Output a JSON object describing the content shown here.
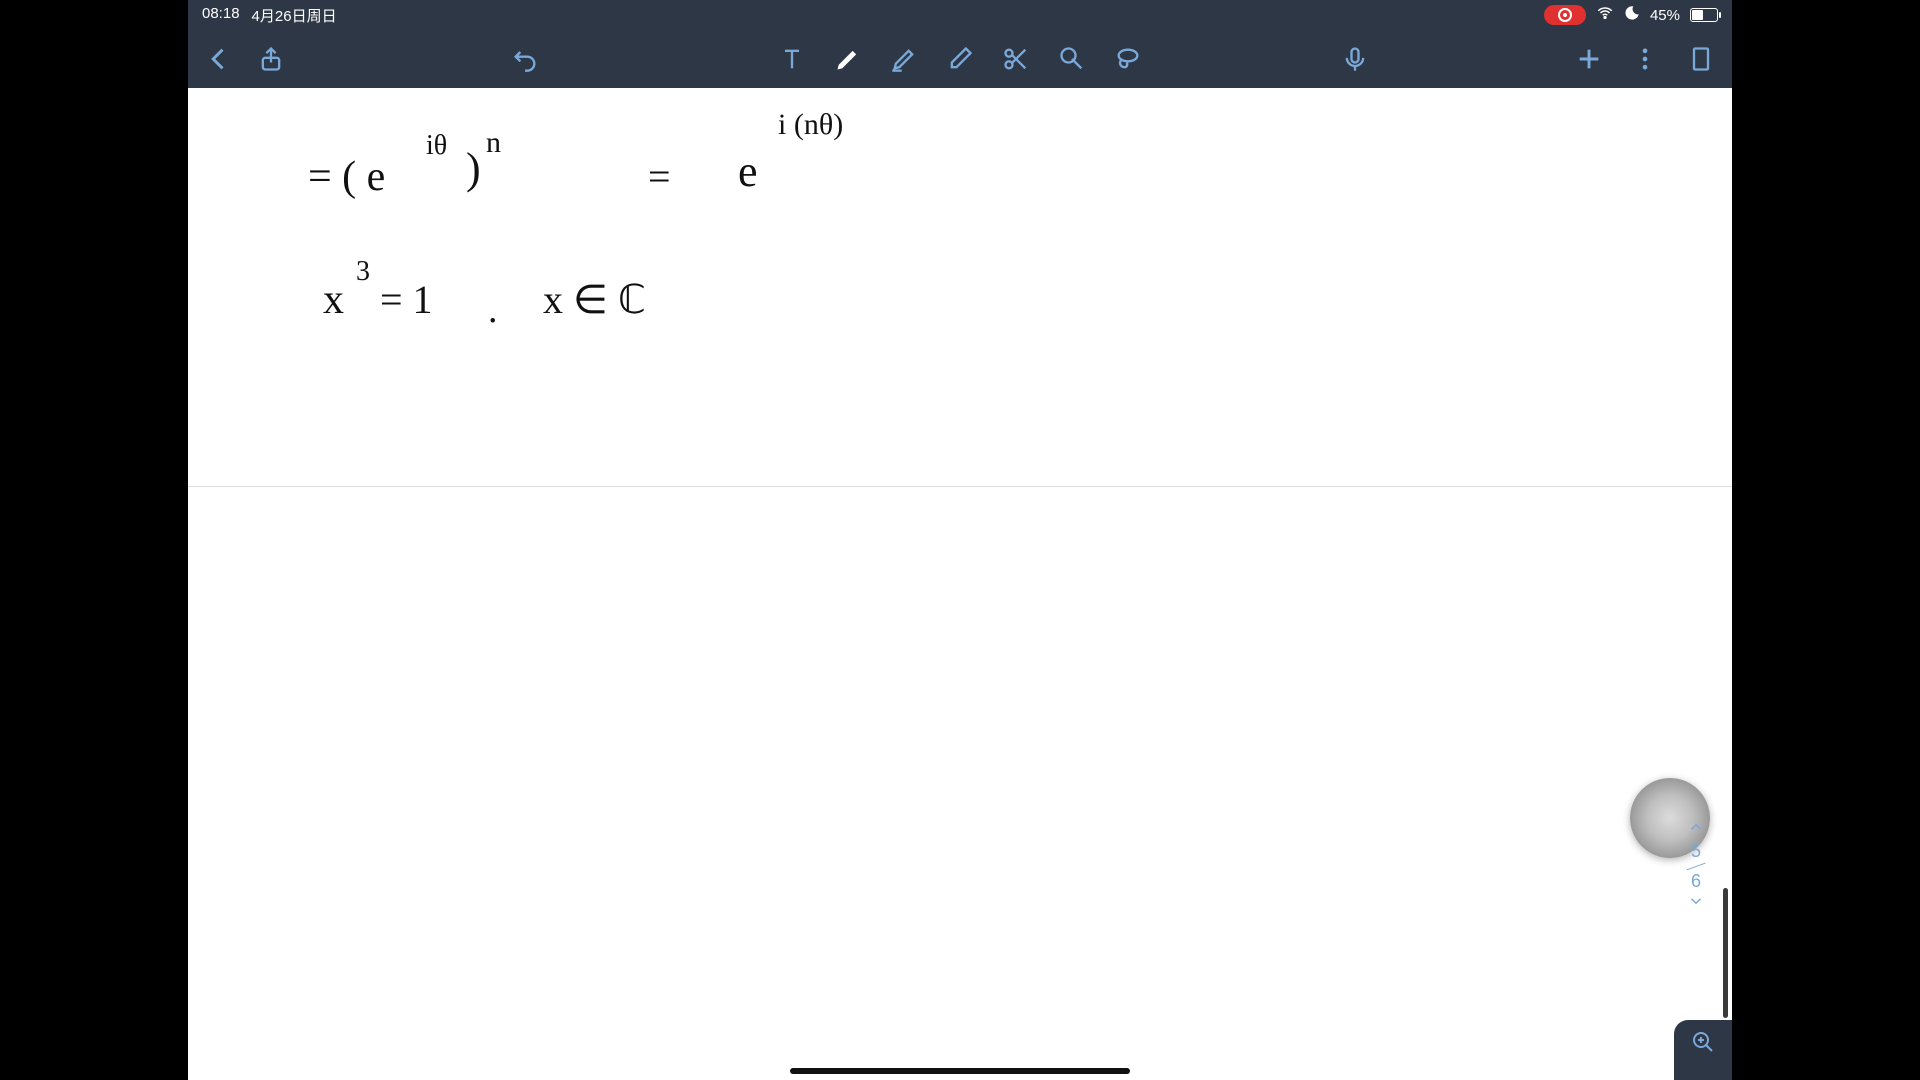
{
  "status": {
    "time": "08:18",
    "date": "4月26日周日",
    "battery_pct": "45%",
    "wifi_glyph": "􀙇",
    "moon_glyph": "☾"
  },
  "pager": {
    "current": "5",
    "total": "6"
  },
  "handwriting": {
    "eq1_lhs": "= ( e",
    "eq1_sup": "iθ",
    "eq1_paren_pow": ")",
    "eq1_pow_n": "n",
    "eq1_rhs_eq": "=",
    "eq1_rhs_e": "e",
    "eq1_rhs_sup": "i (nθ)",
    "eq2_x": "x",
    "eq2_cube": "3",
    "eq2_eq1": "= 1",
    "eq2_comma": ".",
    "eq2_x2": "x ∈ ℂ"
  }
}
